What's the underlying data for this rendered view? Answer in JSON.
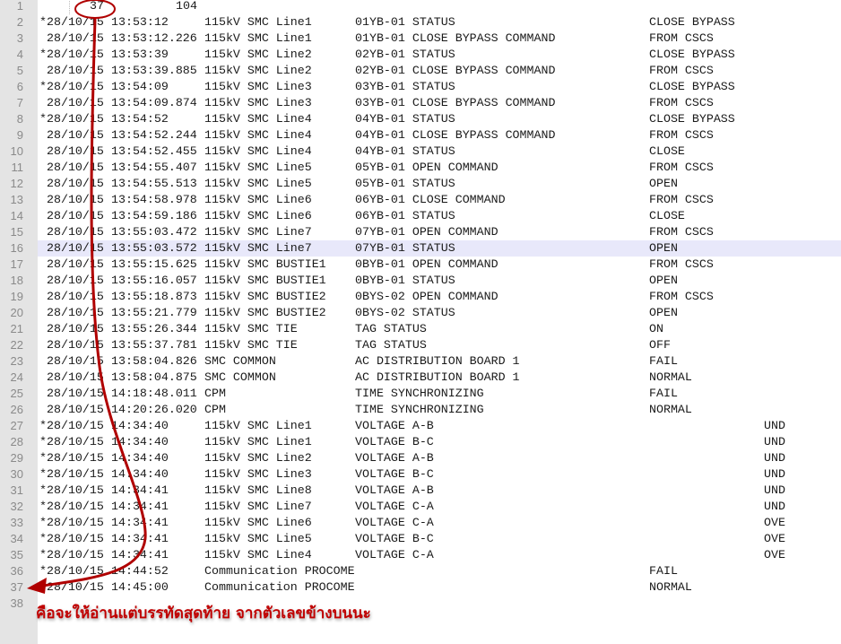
{
  "header_line": {
    "num": "1",
    "a": "37",
    "b": "104"
  },
  "rows": [
    {
      "num": "2",
      "mark": "*",
      "date": "28/10/15",
      "time": "13:53:12",
      "station": "115kV SMC Line1",
      "point": "01YB-01 STATUS",
      "status": "CLOSE BYPASS",
      "val": ""
    },
    {
      "num": "3",
      "mark": "",
      "date": "28/10/15",
      "time": "13:53:12.226",
      "station": "115kV SMC Line1",
      "point": "01YB-01 CLOSE BYPASS COMMAND",
      "status": "FROM CSCS",
      "val": ""
    },
    {
      "num": "4",
      "mark": "*",
      "date": "28/10/15",
      "time": "13:53:39",
      "station": "115kV SMC Line2",
      "point": "02YB-01 STATUS",
      "status": "CLOSE BYPASS",
      "val": ""
    },
    {
      "num": "5",
      "mark": "",
      "date": "28/10/15",
      "time": "13:53:39.885",
      "station": "115kV SMC Line2",
      "point": "02YB-01 CLOSE BYPASS COMMAND",
      "status": "FROM CSCS",
      "val": ""
    },
    {
      "num": "6",
      "mark": "*",
      "date": "28/10/15",
      "time": "13:54:09",
      "station": "115kV SMC Line3",
      "point": "03YB-01 STATUS",
      "status": "CLOSE BYPASS",
      "val": ""
    },
    {
      "num": "7",
      "mark": "",
      "date": "28/10/15",
      "time": "13:54:09.874",
      "station": "115kV SMC Line3",
      "point": "03YB-01 CLOSE BYPASS COMMAND",
      "status": "FROM CSCS",
      "val": ""
    },
    {
      "num": "8",
      "mark": "*",
      "date": "28/10/15",
      "time": "13:54:52",
      "station": "115kV SMC Line4",
      "point": "04YB-01 STATUS",
      "status": "CLOSE BYPASS",
      "val": ""
    },
    {
      "num": "9",
      "mark": "",
      "date": "28/10/15",
      "time": "13:54:52.244",
      "station": "115kV SMC Line4",
      "point": "04YB-01 CLOSE BYPASS COMMAND",
      "status": "FROM CSCS",
      "val": ""
    },
    {
      "num": "10",
      "mark": "",
      "date": "28/10/15",
      "time": "13:54:52.455",
      "station": "115kV SMC Line4",
      "point": "04YB-01 STATUS",
      "status": "CLOSE",
      "val": ""
    },
    {
      "num": "11",
      "mark": "",
      "date": "28/10/15",
      "time": "13:54:55.407",
      "station": "115kV SMC Line5",
      "point": "05YB-01 OPEN COMMAND",
      "status": "FROM CSCS",
      "val": ""
    },
    {
      "num": "12",
      "mark": "",
      "date": "28/10/15",
      "time": "13:54:55.513",
      "station": "115kV SMC Line5",
      "point": "05YB-01 STATUS",
      "status": "OPEN",
      "val": ""
    },
    {
      "num": "13",
      "mark": "",
      "date": "28/10/15",
      "time": "13:54:58.978",
      "station": "115kV SMC Line6",
      "point": "06YB-01 CLOSE COMMAND",
      "status": "FROM CSCS",
      "val": ""
    },
    {
      "num": "14",
      "mark": "",
      "date": "28/10/15",
      "time": "13:54:59.186",
      "station": "115kV SMC Line6",
      "point": "06YB-01 STATUS",
      "status": "CLOSE",
      "val": ""
    },
    {
      "num": "15",
      "mark": "",
      "date": "28/10/15",
      "time": "13:55:03.472",
      "station": "115kV SMC Line7",
      "point": "07YB-01 OPEN COMMAND",
      "status": "FROM CSCS",
      "val": ""
    },
    {
      "num": "16",
      "mark": "",
      "date": "28/10/15",
      "time": "13:55:03.572",
      "station": "115kV SMC Line7",
      "point": "07YB-01 STATUS",
      "status": "OPEN",
      "val": ""
    },
    {
      "num": "17",
      "mark": "",
      "date": "28/10/15",
      "time": "13:55:15.625",
      "station": "115kV SMC BUSTIE1",
      "point": "0BYB-01 OPEN COMMAND",
      "status": "FROM CSCS",
      "val": ""
    },
    {
      "num": "18",
      "mark": "",
      "date": "28/10/15",
      "time": "13:55:16.057",
      "station": "115kV SMC BUSTIE1",
      "point": "0BYB-01 STATUS",
      "status": "OPEN",
      "val": ""
    },
    {
      "num": "19",
      "mark": "",
      "date": "28/10/15",
      "time": "13:55:18.873",
      "station": "115kV SMC BUSTIE2",
      "point": "0BYS-02 OPEN COMMAND",
      "status": "FROM CSCS",
      "val": ""
    },
    {
      "num": "20",
      "mark": "",
      "date": "28/10/15",
      "time": "13:55:21.779",
      "station": "115kV SMC BUSTIE2",
      "point": "0BYS-02 STATUS",
      "status": "OPEN",
      "val": ""
    },
    {
      "num": "21",
      "mark": "",
      "date": "28/10/15",
      "time": "13:55:26.344",
      "station": "115kV SMC TIE",
      "point": "TAG STATUS",
      "status": "ON",
      "val": ""
    },
    {
      "num": "22",
      "mark": "",
      "date": "28/10/15",
      "time": "13:55:37.781",
      "station": "115kV SMC TIE",
      "point": "TAG STATUS",
      "status": "OFF",
      "val": ""
    },
    {
      "num": "23",
      "mark": "",
      "date": "28/10/15",
      "time": "13:58:04.826",
      "station": "SMC COMMON",
      "point": "AC DISTRIBUTION BOARD 1",
      "status": "FAIL",
      "val": ""
    },
    {
      "num": "24",
      "mark": "",
      "date": "28/10/15",
      "time": "13:58:04.875",
      "station": "SMC COMMON",
      "point": "AC DISTRIBUTION BOARD 1",
      "status": "NORMAL",
      "val": ""
    },
    {
      "num": "25",
      "mark": "",
      "date": "28/10/15",
      "time": "14:18:48.011",
      "station": "CPM",
      "point": "TIME SYNCHRONIZING",
      "status": "FAIL",
      "val": ""
    },
    {
      "num": "26",
      "mark": "",
      "date": "28/10/15",
      "time": "14:20:26.020",
      "station": "CPM",
      "point": "TIME SYNCHRONIZING",
      "status": "NORMAL",
      "val": ""
    },
    {
      "num": "27",
      "mark": "*",
      "date": "28/10/15",
      "time": "14:34:40",
      "station": "115kV SMC Line1",
      "point": "VOLTAGE A-B",
      "status": "",
      "val": "UND"
    },
    {
      "num": "28",
      "mark": "*",
      "date": "28/10/15",
      "time": "14:34:40",
      "station": "115kV SMC Line1",
      "point": "VOLTAGE B-C",
      "status": "",
      "val": "UND"
    },
    {
      "num": "29",
      "mark": "*",
      "date": "28/10/15",
      "time": "14:34:40",
      "station": "115kV SMC Line2",
      "point": "VOLTAGE A-B",
      "status": "",
      "val": "UND"
    },
    {
      "num": "30",
      "mark": "*",
      "date": "28/10/15",
      "time": "14:34:40",
      "station": "115kV SMC Line3",
      "point": "VOLTAGE B-C",
      "status": "",
      "val": "UND"
    },
    {
      "num": "31",
      "mark": "*",
      "date": "28/10/15",
      "time": "14:34:41",
      "station": "115kV SMC Line8",
      "point": "VOLTAGE A-B",
      "status": "",
      "val": "UND"
    },
    {
      "num": "32",
      "mark": "*",
      "date": "28/10/15",
      "time": "14:34:41",
      "station": "115kV SMC Line7",
      "point": "VOLTAGE C-A",
      "status": "",
      "val": "UND"
    },
    {
      "num": "33",
      "mark": "*",
      "date": "28/10/15",
      "time": "14:34:41",
      "station": "115kV SMC Line6",
      "point": "VOLTAGE C-A",
      "status": "",
      "val": "OVE"
    },
    {
      "num": "34",
      "mark": "*",
      "date": "28/10/15",
      "time": "14:34:41",
      "station": "115kV SMC Line5",
      "point": "VOLTAGE B-C",
      "status": "",
      "val": "OVE"
    },
    {
      "num": "35",
      "mark": "*",
      "date": "28/10/15",
      "time": "14:34:41",
      "station": "115kV SMC Line4",
      "point": "VOLTAGE C-A",
      "status": "",
      "val": "OVE"
    },
    {
      "num": "36",
      "mark": "*",
      "date": "28/10/15",
      "time": "14:44:52",
      "station": "Communication PROCOME",
      "point": "",
      "status": "FAIL",
      "val": ""
    },
    {
      "num": "37",
      "mark": "*",
      "date": "28/10/15",
      "time": "14:45:00",
      "station": "Communication PROCOME",
      "point": "",
      "status": "NORMAL",
      "val": ""
    }
  ],
  "last_line_num": "38",
  "annotation": {
    "text": "คือจะให้อ่านแต่บรรทัดสุดท้าย จากตัวเลขข้างบนนะ",
    "color": "#c00000"
  },
  "highlight_row": "16"
}
